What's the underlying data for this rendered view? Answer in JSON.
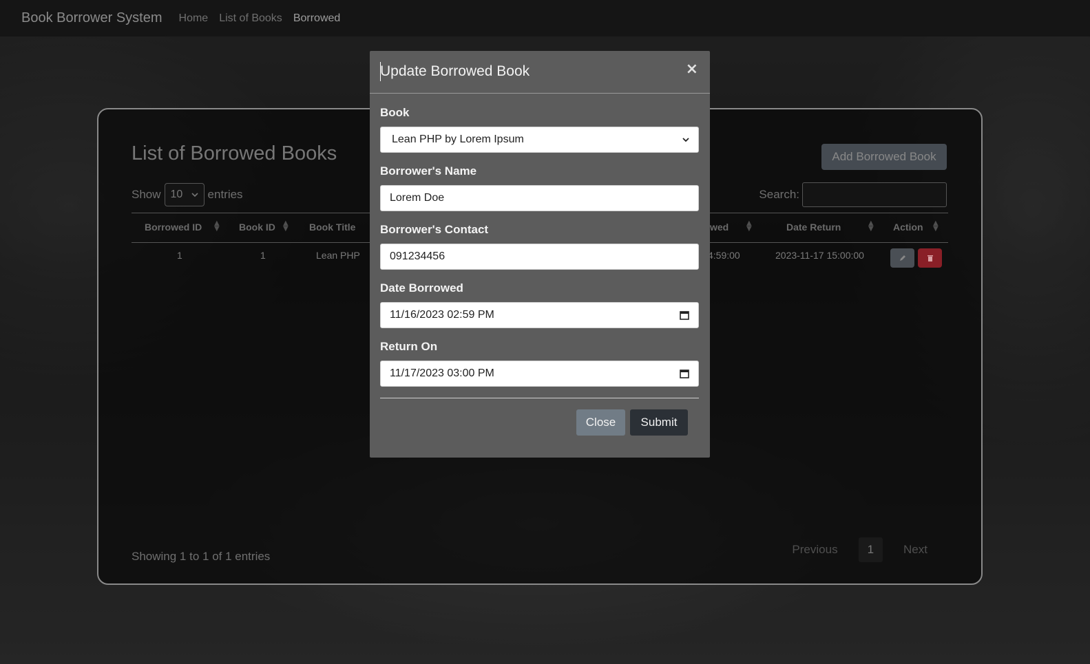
{
  "nav": {
    "brand": "Book Borrower System",
    "links": [
      {
        "label": "Home"
      },
      {
        "label": "List of Books"
      },
      {
        "label": "Borrowed"
      }
    ]
  },
  "card": {
    "title": "List of Borrowed Books",
    "add_button": "Add Borrowed Book",
    "show_label": "Show",
    "entries_label": "entries",
    "page_length": "10",
    "search_label": "Search:",
    "columns": [
      "Borrowed ID",
      "Book ID",
      "Book Title",
      "wed",
      "Date Return",
      "Action"
    ],
    "rows": [
      {
        "borrowed_id": "1",
        "book_id": "1",
        "book_title": "Lean PHP",
        "date_borrowed_partial": "4:59:00",
        "date_return": "2023-11-17 15:00:00"
      }
    ],
    "showing": "Showing 1 to 1 of 1 entries",
    "pager": {
      "previous": "Previous",
      "current": "1",
      "next": "Next"
    }
  },
  "modal": {
    "title": "Update Borrowed Book",
    "close_symbol": "×",
    "book_label": "Book",
    "book_value": "Lean PHP by Lorem Ipsum",
    "name_label": "Borrower's Name",
    "name_value": "Lorem Doe",
    "contact_label": "Borrower's Contact",
    "contact_value": "091234456",
    "date_borrowed_label": "Date Borrowed",
    "date_borrowed_value": "11/16/2023 02:59 PM",
    "return_label": "Return On",
    "return_value": "11/17/2023 03:00 PM",
    "close_button": "Close",
    "submit_button": "Submit"
  },
  "icons": {
    "select_chevron": "chevron-down-icon",
    "calendar": "calendar-icon",
    "edit": "pencil-icon",
    "delete": "trash-icon"
  },
  "colors": {
    "modal_bg": "#5c5c5c",
    "submit_bg": "#2b3036",
    "close_bg": "#717c86",
    "delete_bg": "#8a1f27"
  }
}
